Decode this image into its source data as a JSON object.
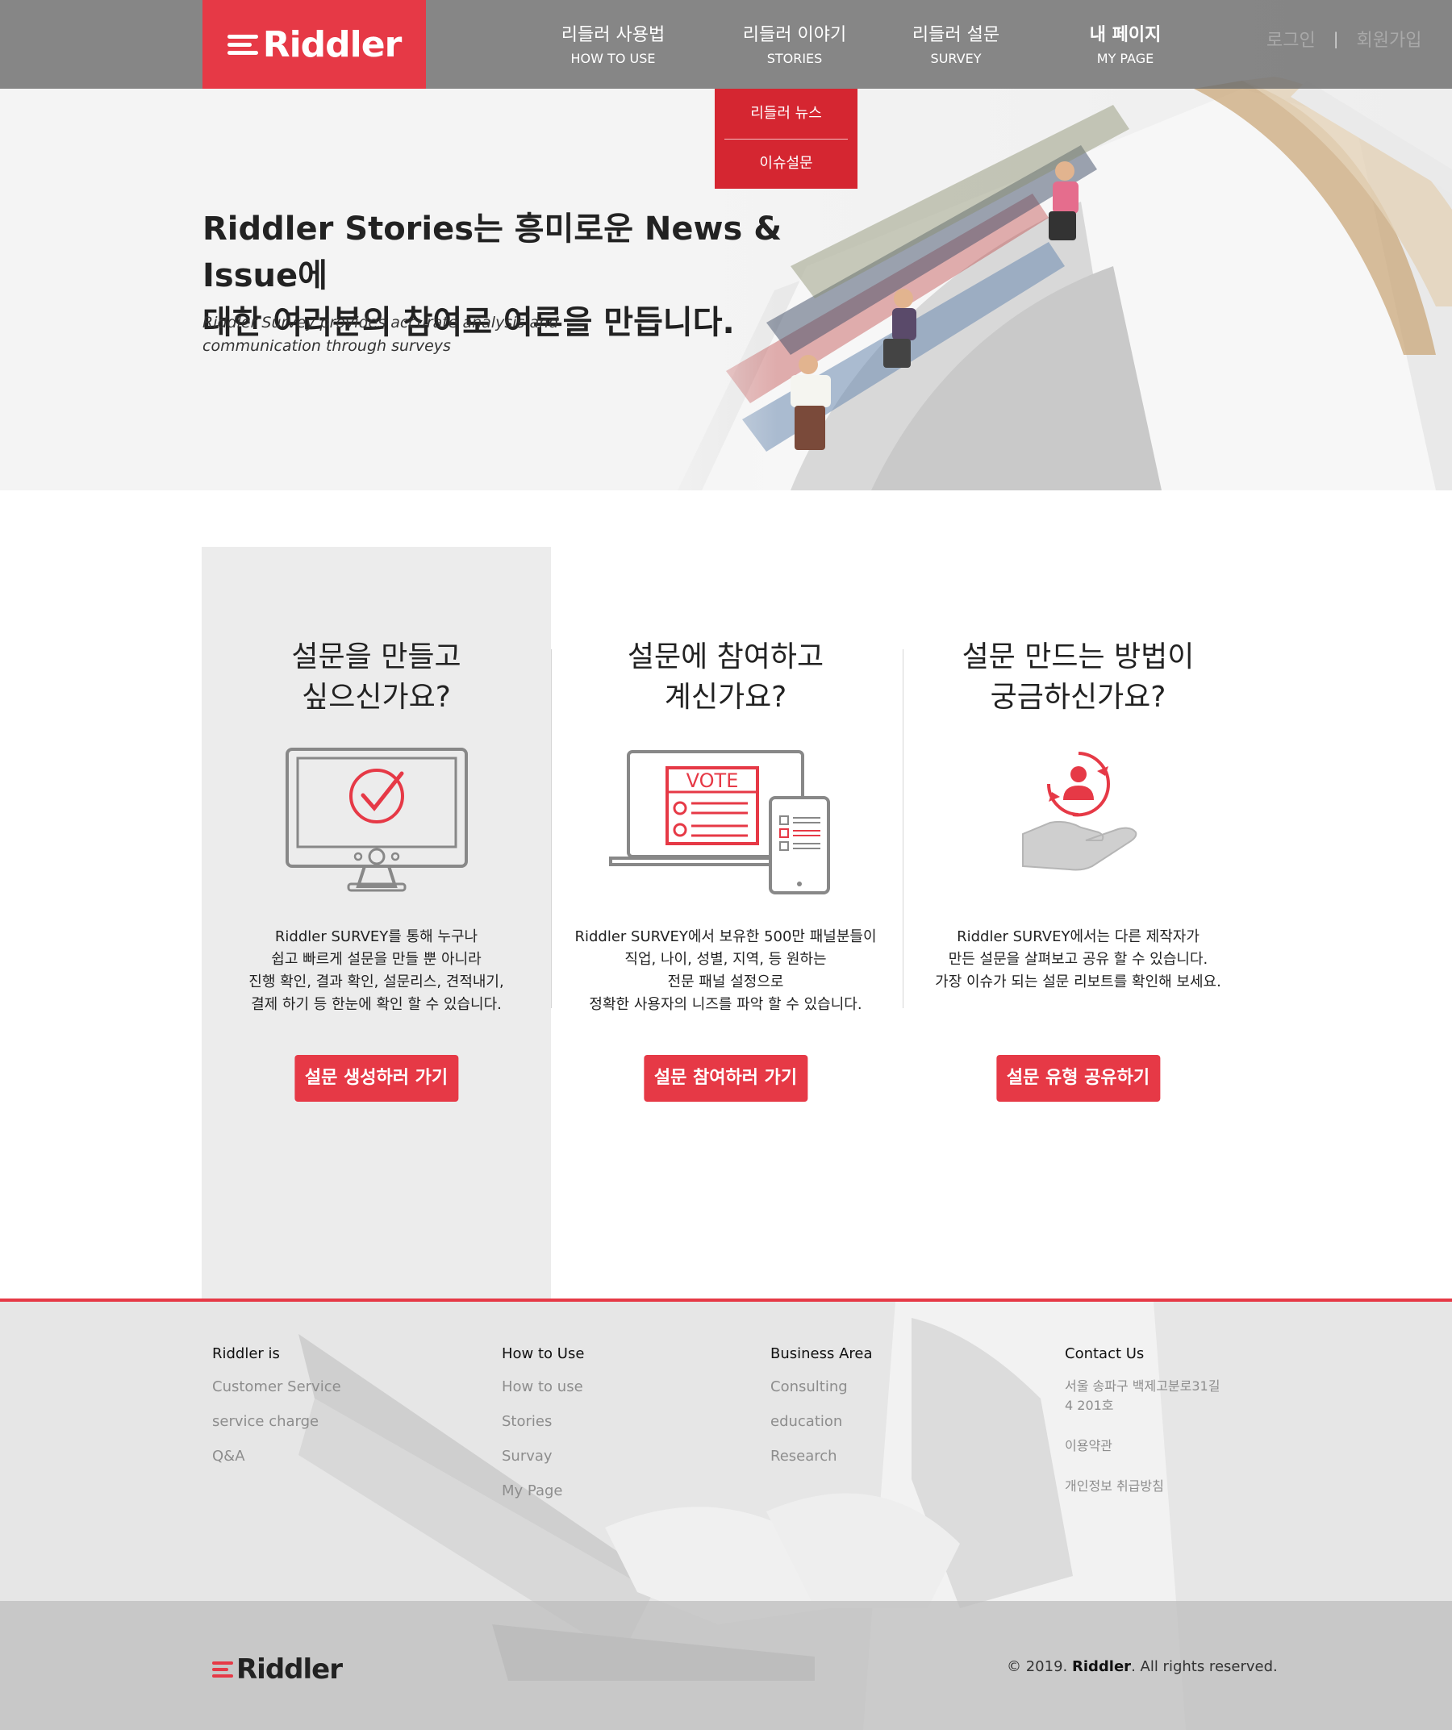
{
  "brand": {
    "name": "Riddler",
    "accent": "#e63946"
  },
  "nav": [
    {
      "ko": "리들러 사용법",
      "en": "HOW TO USE"
    },
    {
      "ko": "리들러 이야기",
      "en": "STORIES"
    },
    {
      "ko": "리들러 설문",
      "en": "SURVEY"
    },
    {
      "ko": "내 페이지",
      "en": "MY PAGE"
    }
  ],
  "auth": {
    "login": "로그인",
    "separator": "|",
    "signup": "회원가입"
  },
  "dropdown": [
    "리들러 뉴스",
    "이슈설문"
  ],
  "hero": {
    "title_bold": "Riddler Stories",
    "title_rest": "는 흥미로운 News & Issue에",
    "title_line2": "대한 여러분의 참여로 여론을 만듭니다.",
    "subtitle_1": "Riddler Survey provides accurate analysis and",
    "subtitle_2": "communication through surveys"
  },
  "features": [
    {
      "title_1": "설문을 만들고",
      "title_2": "싶으신가요?",
      "icon": "monitor-check-icon",
      "desc": [
        "Riddler SURVEY를 통해 누구나",
        "쉽고 빠르게 설문을 만들 뿐 아니라",
        "진행 확인, 결과 확인, 설문리스, 견적내기,",
        "결제 하기 등 한눈에 확인 할 수 있습니다."
      ],
      "button": "설문 생성하러 가기"
    },
    {
      "title_1": "설문에 참여하고",
      "title_2": "계신가요?",
      "icon": "vote-laptop-icon",
      "icon_text": "VOTE",
      "desc": [
        "Riddler SURVEY에서 보유한 500만 패널분들이",
        "직업, 나이, 성별, 지역, 등 원하는",
        "전문 패널 설정으로",
        "정확한 사용자의 니즈를 파악 할 수 있습니다."
      ],
      "button": "설문 참여하러 가기"
    },
    {
      "title_1": "설문 만드는 방법이",
      "title_2": "궁금하신가요?",
      "icon": "hand-user-cycle-icon",
      "desc": [
        "Riddler SURVEY에서는 다른 제작자가",
        "만든 설문을 살펴보고 공유 할 수 있습니다.",
        "가장 이슈가 되는 설문 리보트를 확인해 보세요."
      ],
      "button": "설문 유형 공유하기"
    }
  ],
  "footer": {
    "columns": [
      {
        "title": "Riddler is",
        "links": [
          "Customer Service",
          "service charge",
          "Q&A"
        ]
      },
      {
        "title": "How to Use",
        "links": [
          "How to use",
          "Stories",
          "Survay",
          "My Page"
        ]
      },
      {
        "title": "Business Area",
        "links": [
          "Consulting",
          "education",
          "Research"
        ]
      },
      {
        "title": "Contact Us",
        "links": [
          "서울 송파구 백제고분로31길 4 201호",
          "이용약관",
          "개인정보 취급방침"
        ]
      }
    ],
    "copyright_year": "© 2019.",
    "copyright_brand": "Riddler",
    "copyright_rest": ". All rights reserved."
  }
}
